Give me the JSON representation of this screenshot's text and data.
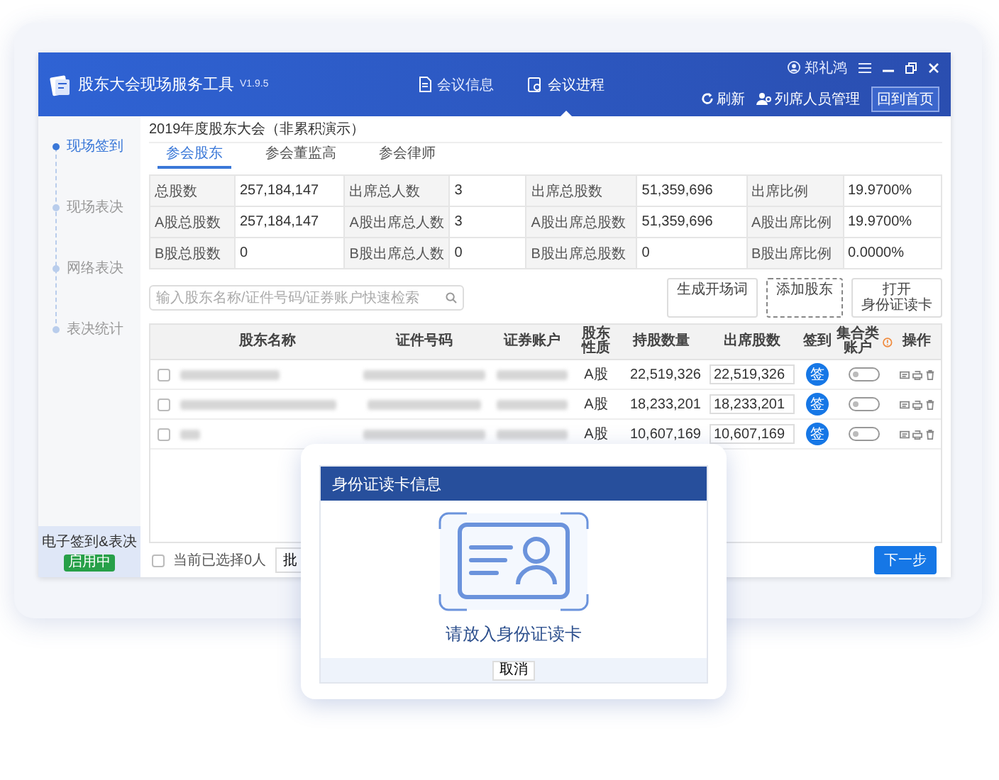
{
  "app": {
    "title": "股东大会现场服务工具",
    "version": "V1.9.5"
  },
  "nav": [
    {
      "label": "会议信息",
      "kind": "doc",
      "selected": false
    },
    {
      "label": "会议进程",
      "kind": "progress",
      "selected": true
    }
  ],
  "user": {
    "name": "郑礼鸿"
  },
  "toolbar": [
    {
      "label": "刷新",
      "kind": "refresh"
    },
    {
      "label": "列席人员管理",
      "kind": "people"
    }
  ],
  "home_button": "回到首页",
  "sidebar": {
    "steps": [
      {
        "label": "现场签到",
        "selected": true
      },
      {
        "label": "现场表决",
        "selected": false
      },
      {
        "label": "网络表决",
        "selected": false
      },
      {
        "label": "表决统计",
        "selected": false
      }
    ],
    "footer": {
      "label": "电子签到&表决",
      "badge": "启用中"
    }
  },
  "meeting_title": "2019年度股东大会（非累积演示）",
  "tabs": [
    {
      "label": "参会股东",
      "selected": true
    },
    {
      "label": "参会董监高",
      "selected": false
    },
    {
      "label": "参会律师",
      "selected": false
    }
  ],
  "stats": [
    [
      {
        "label": "总股数",
        "value": "257,184,147"
      },
      {
        "label": "出席总人数",
        "value": "3"
      },
      {
        "label": "出席总股数",
        "value": "51,359,696"
      },
      {
        "label": "出席比例",
        "value": "19.9700%"
      }
    ],
    [
      {
        "label": "A股总股数",
        "value": "257,184,147"
      },
      {
        "label": "A股出席总人数",
        "value": "3"
      },
      {
        "label": "A股出席总股数",
        "value": "51,359,696"
      },
      {
        "label": "A股出席比例",
        "value": "19.9700%"
      }
    ],
    [
      {
        "label": "B股总股数",
        "value": "0"
      },
      {
        "label": "B股出席总人数",
        "value": "0"
      },
      {
        "label": "B股出席总股数",
        "value": "0"
      },
      {
        "label": "B股出席比例",
        "value": "0.0000%"
      }
    ]
  ],
  "search": {
    "placeholder": "输入股东名称/证件号码/证券账户快速检索"
  },
  "actions": [
    {
      "lines": [
        "生成开场词"
      ]
    },
    {
      "lines": [
        "添加股东"
      ]
    },
    {
      "lines": [
        "打开",
        "身份证读卡"
      ]
    }
  ],
  "table": {
    "columns": [
      "股东名称",
      "证件号码",
      "证券账户",
      "股东性质",
      "持股数量",
      "出席股数",
      "签到",
      "集合类账户",
      "操作"
    ],
    "rows": [
      {
        "checked": false,
        "share_type": "A股",
        "holdings": "22,519,326",
        "attending": "22,519,326",
        "sign": "签",
        "aggregate": false
      },
      {
        "checked": false,
        "share_type": "A股",
        "holdings": "18,233,201",
        "attending": "18,233,201",
        "sign": "签",
        "aggregate": false
      },
      {
        "checked": false,
        "share_type": "A股",
        "holdings": "10,607,169",
        "attending": "10,607,169",
        "sign": "签",
        "aggregate": false
      }
    ]
  },
  "footer": {
    "checked": false,
    "selected_count": "当前已选择0人",
    "batch_button": "批",
    "next_button": "下一步"
  },
  "dialog": {
    "title": "身份证读卡信息",
    "prompt": "请放入身份证读卡",
    "cancel": "取消"
  }
}
